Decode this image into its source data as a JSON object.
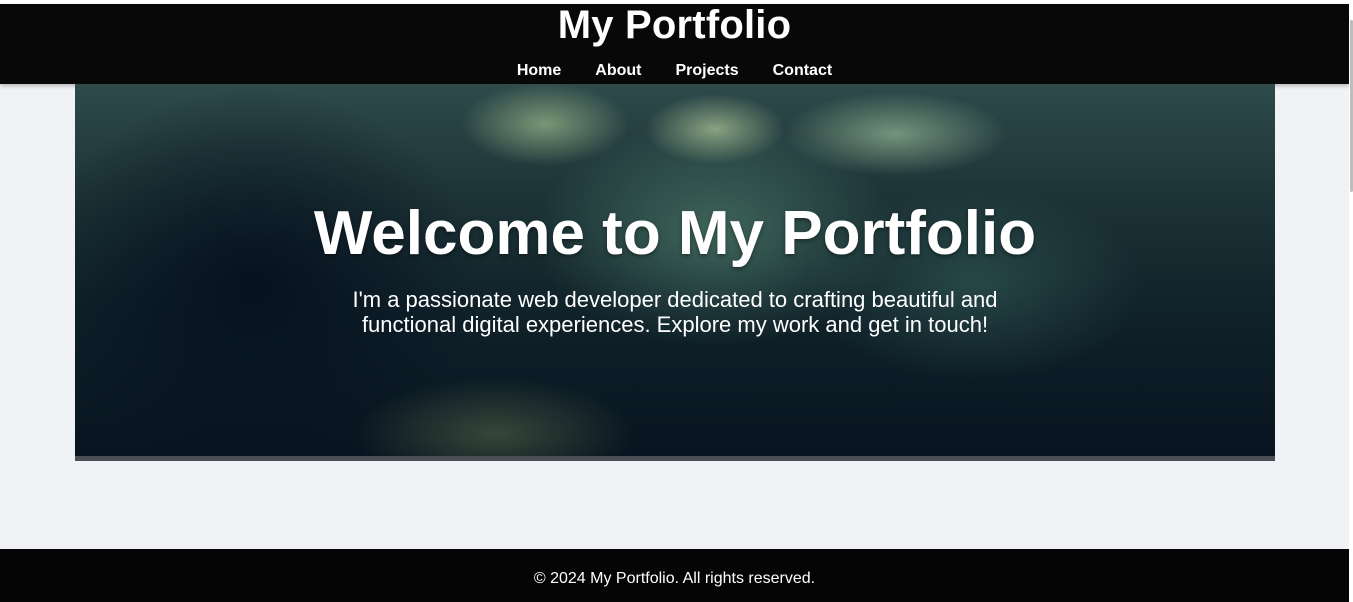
{
  "header": {
    "title": "My Portfolio",
    "nav": [
      {
        "label": "Home"
      },
      {
        "label": "About"
      },
      {
        "label": "Projects"
      },
      {
        "label": "Contact"
      }
    ]
  },
  "hero": {
    "title": "Welcome to My Portfolio",
    "text": "I'm a passionate web developer dedicated to crafting beautiful and functional digital experiences. Explore my work and get in touch!"
  },
  "footer": {
    "text": "© 2024 My Portfolio. All rights reserved."
  },
  "colors": {
    "header_bg": "#080808",
    "footer_bg": "#050505",
    "page_bg": "#f0f2f5",
    "text": "#ffffff"
  }
}
